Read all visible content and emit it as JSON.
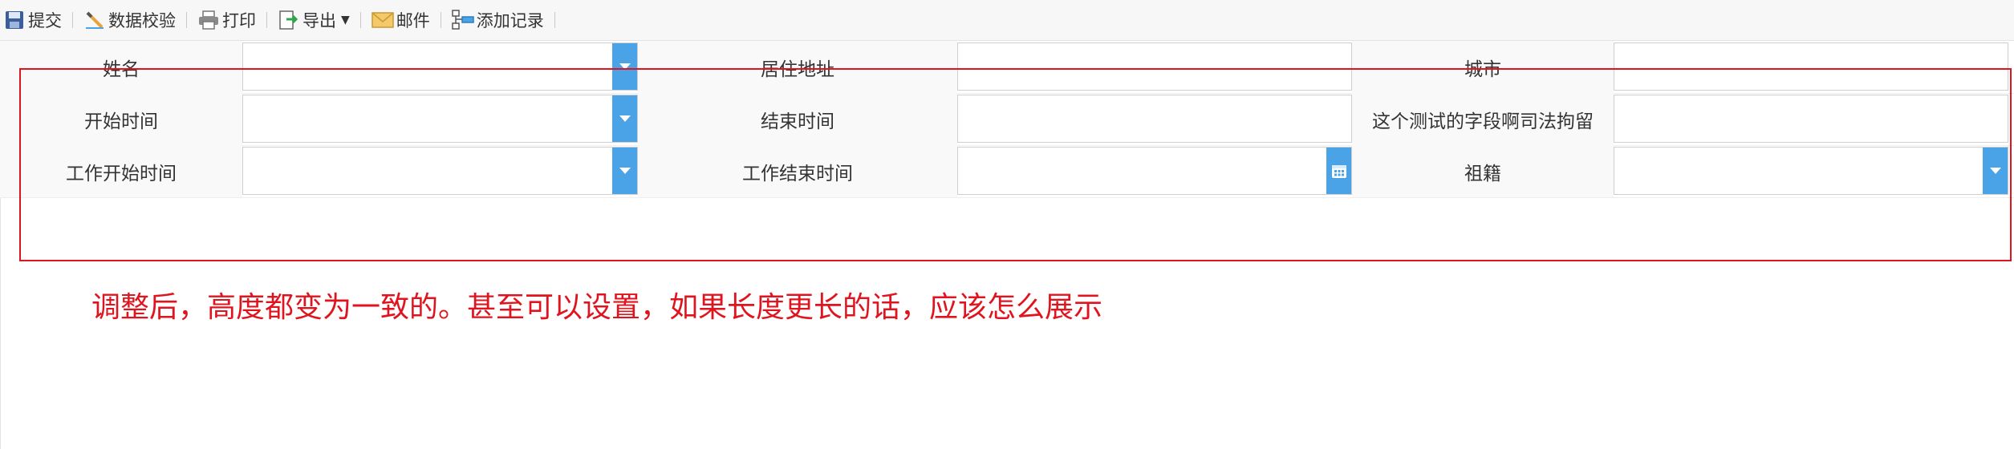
{
  "toolbar": {
    "buttons": [
      {
        "label": "提交",
        "icon": "save-icon"
      },
      {
        "label": "数据校验",
        "icon": "validate-icon"
      },
      {
        "label": "打印",
        "icon": "print-icon"
      },
      {
        "label": "导出",
        "icon": "export-icon"
      },
      {
        "label": "邮件",
        "icon": "mail-icon"
      },
      {
        "label": "添加记录",
        "icon": "add-record-icon"
      }
    ]
  },
  "form": {
    "rows": [
      [
        {
          "label": "姓名",
          "value": "",
          "control": "dropdown"
        },
        {
          "label": "居住地址",
          "value": "",
          "control": "text"
        },
        {
          "label": "城市",
          "value": "",
          "control": "text"
        }
      ],
      [
        {
          "label": "开始时间",
          "value": "",
          "control": "dropdown"
        },
        {
          "label": "结束时间",
          "value": "",
          "control": "text"
        },
        {
          "label": "这个测试的字段啊司法拘留",
          "value": "",
          "control": "text"
        }
      ],
      [
        {
          "label": "工作开始时间",
          "value": "",
          "control": "dropdown"
        },
        {
          "label": "工作结束时间",
          "value": "",
          "control": "date"
        },
        {
          "label": "祖籍",
          "value": "",
          "control": "dropdown"
        }
      ]
    ]
  },
  "annotation": {
    "note": "调整后，高度都变为一致的。甚至可以设置，如果长度更长的话，应该怎么展示",
    "color": "#e0141e"
  },
  "colors": {
    "accent": "#4aa3e6",
    "label_bg": "#f9f9f9",
    "toolbar_bg": "#f7f7f7"
  }
}
